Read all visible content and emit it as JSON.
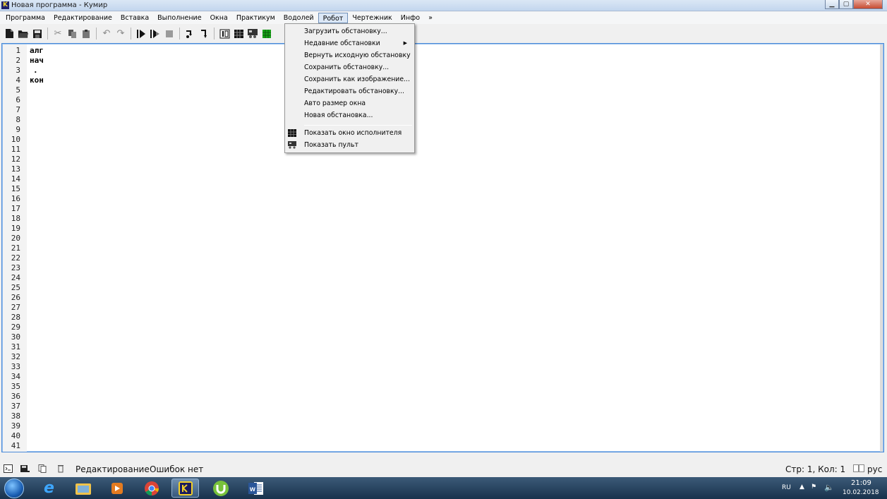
{
  "window": {
    "title": "Новая программа - Кумир",
    "app_icon_letter": "K"
  },
  "menubar": {
    "items": [
      "Программа",
      "Редактирование",
      "Вставка",
      "Выполнение",
      "Окна",
      "Практикум",
      "Водолей",
      "Робот",
      "Чертежник",
      "Инфо",
      "»"
    ],
    "open_item": "Робот"
  },
  "toolbar": {
    "icons": [
      "new-file-icon",
      "open-folder-icon",
      "save-icon",
      "cut-icon",
      "copy-icon",
      "paste-icon",
      "undo-icon",
      "redo-icon",
      "run-icon",
      "run-step-icon",
      "stop-icon",
      "step-over-icon",
      "step-into-icon",
      "robot-field-icon",
      "grid-icon",
      "robot-remote-icon",
      "robot-green-icon"
    ]
  },
  "editor": {
    "line_numbers": [
      "1",
      "2",
      "3",
      "4",
      "5",
      "6",
      "7",
      "8",
      "9",
      "10",
      "11",
      "12",
      "13",
      "14",
      "15",
      "16",
      "17",
      "18",
      "19",
      "20",
      "21",
      "22",
      "23",
      "24",
      "25",
      "26",
      "27",
      "28",
      "29",
      "30",
      "31",
      "32",
      "33",
      "34",
      "35",
      "36",
      "37",
      "38",
      "39",
      "40",
      "41"
    ],
    "code_lines": [
      "алг",
      "нач",
      ".",
      "кон"
    ]
  },
  "robot_menu": {
    "items": [
      {
        "label": "Загрузить обстановку..."
      },
      {
        "label": "Недавние обстановки",
        "submenu": true
      },
      {
        "label": "Вернуть исходную обстановку"
      },
      {
        "label": "Сохранить обстановку..."
      },
      {
        "label": "Сохранить как изображение..."
      },
      {
        "label": "Редактировать обстановку..."
      },
      {
        "label": "Авто размер окна"
      },
      {
        "label": "Новая обстановка..."
      },
      {
        "label": "Показать окно исполнителя",
        "icon": "grid-icon"
      },
      {
        "label": "Показать пульт",
        "icon": "robot-remote-icon"
      }
    ]
  },
  "statusbar": {
    "mode": "Редактирование",
    "errors": "Ошибок нет",
    "position": "Стр: 1, Кол: 1",
    "keyboard": "рус"
  },
  "taskbar": {
    "apps": [
      "internet-explorer-icon",
      "file-explorer-icon",
      "media-player-icon",
      "chrome-icon",
      "kumir-icon",
      "utorrent-icon",
      "word-icon"
    ],
    "language": "RU",
    "time": "21:09",
    "date": "10.02.2018"
  }
}
